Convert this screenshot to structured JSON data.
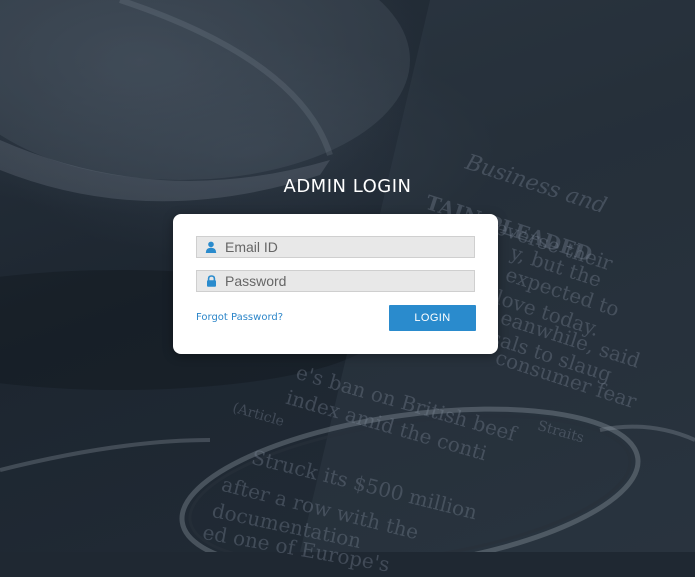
{
  "page": {
    "title": "ADMIN LOGIN"
  },
  "form": {
    "email_placeholder": "Email ID",
    "email_value": "",
    "password_placeholder": "Password",
    "password_value": "",
    "forgot_label": "Forgot Password?",
    "login_label": "LOGIN"
  },
  "icons": {
    "email": "user-icon",
    "password": "lock-icon"
  },
  "colors": {
    "accent": "#2a8bcd",
    "link": "#2d86c9",
    "background": "#1f2832",
    "card": "#ffffff"
  },
  "background_text": [
    "Business and",
    "TAIN PLEADED",
    "everse their",
    "y, but the",
    "expected to",
    "love today.",
    "eanwhile, said",
    "sals to slaug",
    "consumer fear",
    "e's ban on British beef",
    "index amid the conti",
    "(Article",
    "Straits",
    "Struck its $500 million",
    "after a row with the",
    "documentation",
    "ed one of Europe's"
  ]
}
